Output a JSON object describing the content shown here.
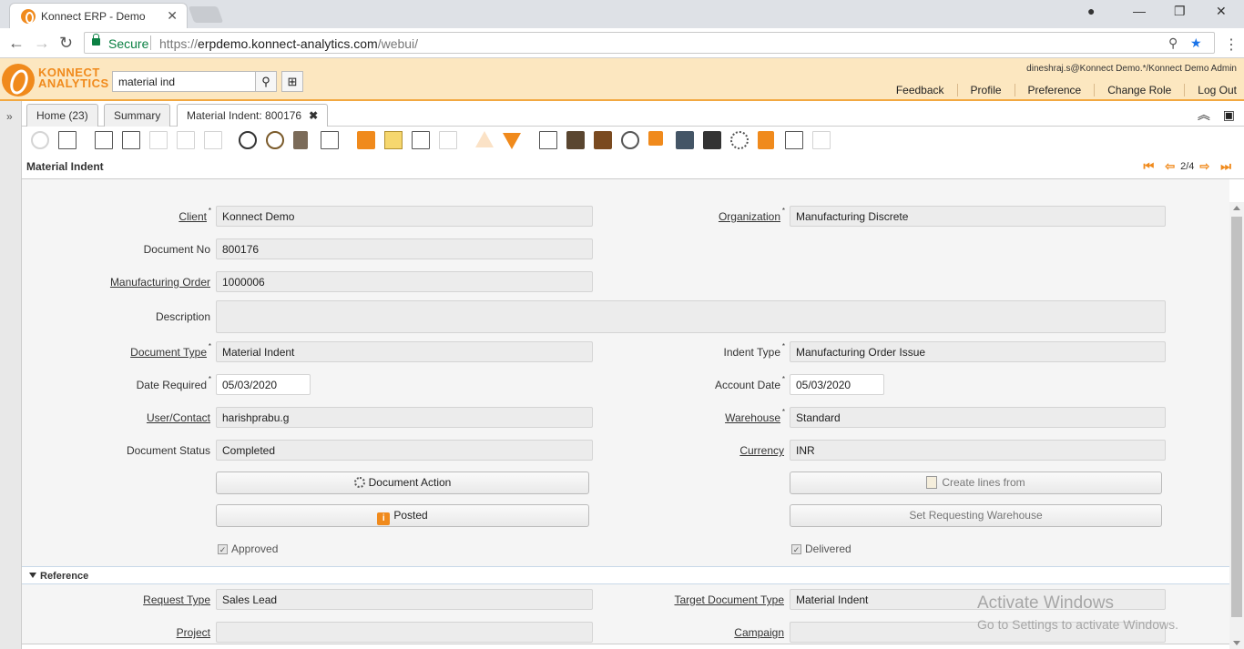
{
  "browser": {
    "tab_title": "Konnect ERP - Demo",
    "secure_label": "Secure",
    "url_prefix": "https://",
    "url_host": "erpdemo.konnect-analytics.com",
    "url_path": "/webui/"
  },
  "header": {
    "logo_line1": "KONNECT",
    "logo_line2": "ANALYTICS",
    "search_value": "material ind",
    "user_info": "dineshraj.s@Konnect Demo.*/Konnect Demo Admin",
    "links": [
      "Feedback",
      "Profile",
      "Preference",
      "Change Role",
      "Log Out"
    ]
  },
  "tabs": {
    "home": "Home (23)",
    "summary": "Summary",
    "active": "Material Indent: 800176"
  },
  "window": {
    "title": "Material Indent",
    "record": "2/4"
  },
  "form": {
    "client": {
      "label": "Client",
      "value": "Konnect Demo"
    },
    "organization": {
      "label": "Organization",
      "value": "Manufacturing Discrete"
    },
    "document_no": {
      "label": "Document No",
      "value": "800176"
    },
    "manufacturing_order": {
      "label": "Manufacturing Order",
      "value": "1000006"
    },
    "description": {
      "label": "Description",
      "value": ""
    },
    "document_type": {
      "label": "Document Type",
      "value": "Material Indent"
    },
    "indent_type": {
      "label": "Indent Type",
      "value": "Manufacturing Order Issue"
    },
    "date_required": {
      "label": "Date Required",
      "value": "05/03/2020"
    },
    "account_date": {
      "label": "Account Date",
      "value": "05/03/2020"
    },
    "user_contact": {
      "label": "User/Contact",
      "value": "harishprabu.g"
    },
    "warehouse": {
      "label": "Warehouse",
      "value": "Standard"
    },
    "document_status": {
      "label": "Document Status",
      "value": "Completed"
    },
    "currency": {
      "label": "Currency",
      "value": "INR"
    },
    "document_action_btn": "Document Action",
    "posted_btn": "Posted",
    "create_lines_btn": "Create lines from",
    "set_warehouse_btn": "Set Requesting Warehouse",
    "approved": "Approved",
    "delivered": "Delivered"
  },
  "reference": {
    "section_title": "Reference",
    "request_type": {
      "label": "Request Type",
      "value": "Sales Lead"
    },
    "target_document_type": {
      "label": "Target Document Type",
      "value": "Material Indent"
    },
    "project": {
      "label": "Project",
      "value": ""
    },
    "campaign": {
      "label": "Campaign",
      "value": ""
    }
  },
  "watermark": {
    "line1": "Activate Windows",
    "line2": "Go to Settings to activate Windows."
  }
}
